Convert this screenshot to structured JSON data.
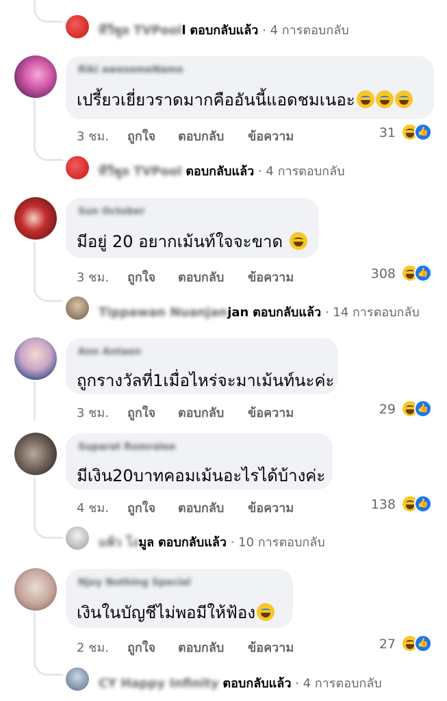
{
  "reply_summary": {
    "replied_suffix": "ตอบกลับแล้ว",
    "dot": " · "
  },
  "comments": [
    {
      "name": "Riki awesomeName",
      "text": "เปรี้ยวเยี่ยวราดมากคืออันนี้แอดชมเนอะ",
      "time": "3 ชม.",
      "like": "ถูกใจ",
      "reply": "ตอบกลับ",
      "message": "ข้อความ",
      "reactions": "31",
      "page_reply": {
        "name": "ทีวีพูล TVPool",
        "count": "4 การตอบกลับ"
      }
    },
    {
      "name": "Sun October",
      "text": "มีอยู่ 20 อยากเม้นท์ใจจะขาด",
      "time": "3 ชม.",
      "like": "ถูกใจ",
      "reply": "ตอบกลับ",
      "message": "ข้อความ",
      "reactions": "308",
      "page_reply": {
        "name_hidden": "Tippawan Nuanjan",
        "name_visible": "jan",
        "count": "14 การตอบกลับ"
      }
    },
    {
      "name": "Ann Antaen",
      "text": "ถูกรางวัลที่1เมื่อไหร่จะมาเม้นท์นะค่ะ",
      "time": "3 ชม.",
      "like": "ถูกใจ",
      "reply": "ตอบกลับ",
      "message": "ข้อความ",
      "reactions": "29"
    },
    {
      "name": "Suparat Romralee",
      "text": "มีเงิน20บาทคอมเม้นอะไรได้บ้างค่ะ",
      "time": "4 ชม.",
      "like": "ถูกใจ",
      "reply": "ตอบกลับ",
      "message": "ข้อความ",
      "reactions": "138",
      "page_reply": {
        "name_hidden": "แพ้ว โง",
        "name_visible": "มูล",
        "count": "10 การตอบกลับ"
      }
    },
    {
      "name": "Njoy Nothing Special",
      "text": "เงินในบัญชีไม่พอมีให้ฟ้อง",
      "time": "2 ชม.",
      "like": "ถูกใจ",
      "reply": "ตอบกลับ",
      "message": "ข้อความ",
      "reactions": "27",
      "page_reply": {
        "name": "CY Happy Infinity",
        "count": "4 การตอบกลับ"
      }
    }
  ],
  "top_reply": {
    "name": "ทีวีพูล TVPool",
    "visible_tail": "l",
    "count": "4 การตอบกลับ"
  },
  "icons": {
    "reaction_1": "laugh-icon",
    "reaction_2": "like-icon"
  },
  "colors": {
    "bubble": "#f0f2f5",
    "meta": "#65676b",
    "like_blue": "#1877f2",
    "laugh_yellow": "#f7c629"
  }
}
